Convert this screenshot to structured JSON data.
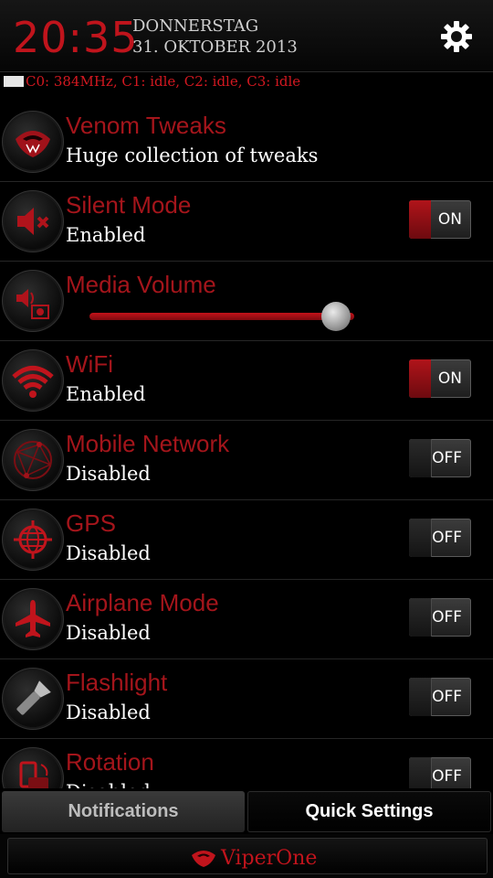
{
  "status": {
    "time": "20:35",
    "day": "DONNERSTAG",
    "date": "31. OKTOBER 2013",
    "settings_icon": "gear-icon"
  },
  "cpu_info": "C0: 384MHz, C1: idle, C2: idle, C3: idle",
  "rows": [
    {
      "title": "Venom Tweaks",
      "subtitle": "Huge collection of tweaks",
      "icon": "venom-snake-icon"
    },
    {
      "title": "Silent Mode",
      "subtitle": "Enabled",
      "icon": "speaker-muted-icon",
      "toggle": "ON"
    },
    {
      "title": "Media Volume",
      "icon": "media-speaker-icon",
      "volume_level": 0.93
    },
    {
      "title": "WiFi",
      "subtitle": "Enabled",
      "icon": "wifi-icon",
      "toggle": "ON"
    },
    {
      "title": "Mobile Network",
      "subtitle": "Disabled",
      "icon": "mobile-network-icon",
      "toggle": "OFF"
    },
    {
      "title": "GPS",
      "subtitle": "Disabled",
      "icon": "gps-globe-icon",
      "toggle": "OFF"
    },
    {
      "title": "Airplane Mode",
      "subtitle": "Disabled",
      "icon": "airplane-icon",
      "toggle": "OFF"
    },
    {
      "title": "Flashlight",
      "subtitle": "Disabled",
      "icon": "flashlight-icon",
      "toggle": "OFF"
    },
    {
      "title": "Rotation",
      "subtitle": "Disabled",
      "icon": "rotation-icon",
      "toggle": "OFF"
    }
  ],
  "tabs": {
    "notifications": "Notifications",
    "quick_settings": "Quick Settings",
    "active": "Quick Settings"
  },
  "footer": {
    "brand": "ViperOne",
    "logo": "viper-logo-icon"
  },
  "colors": {
    "accent": "#c0141c",
    "background": "#000000"
  }
}
